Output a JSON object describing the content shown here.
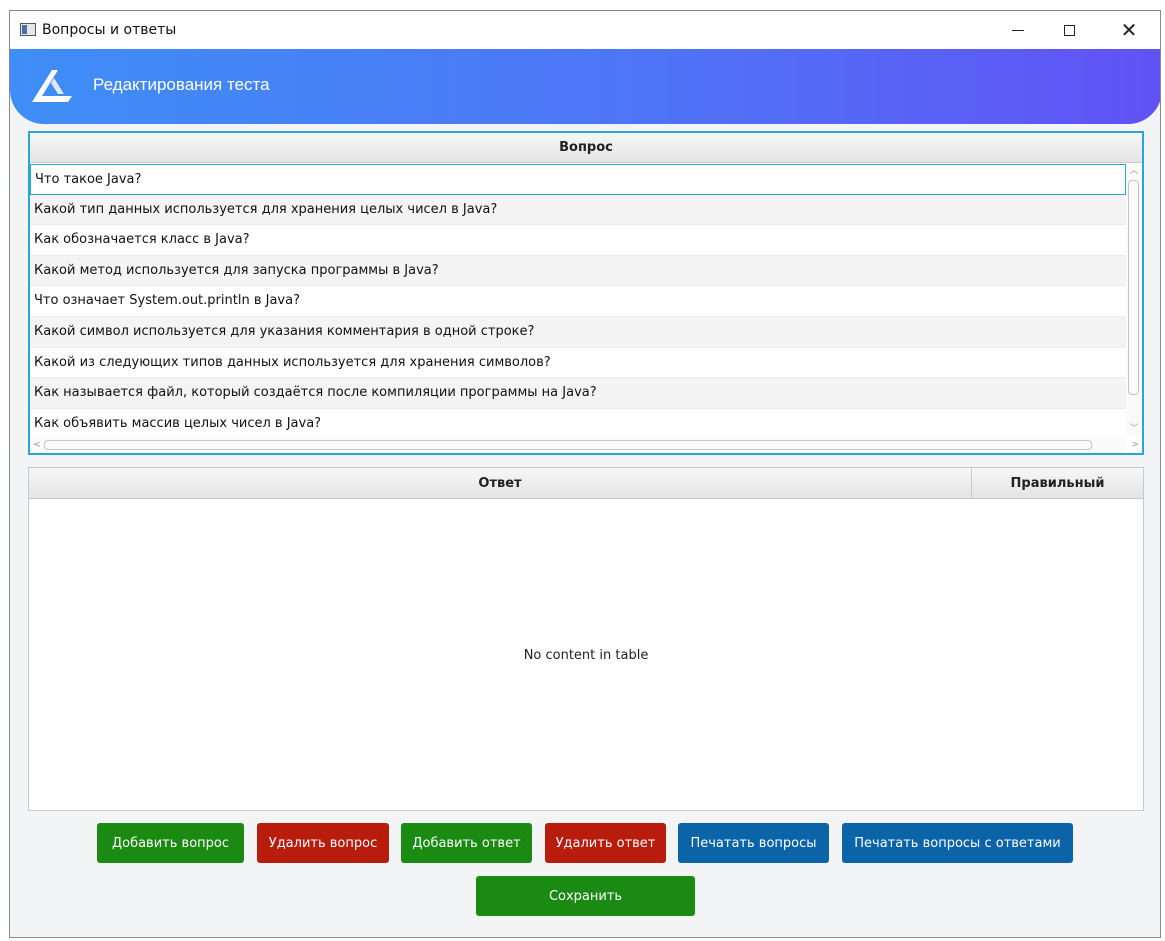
{
  "window": {
    "title": "Вопросы и ответы",
    "controls": {
      "minimize": "minimize",
      "maximize": "maximize",
      "close": "✕"
    }
  },
  "banner": {
    "title": "Редактирования теста",
    "gradient_start": "#3f8ef7",
    "gradient_end": "#6152f5"
  },
  "questions_table": {
    "header": "Вопрос",
    "selected_index": 0,
    "rows": [
      "Что такое Java?",
      "Какой тип данных используется для хранения целых чисел в Java?",
      "Как обозначается класс в Java?",
      "Какой метод используется для запуска программы в Java?",
      "Что означает System.out.println в Java?",
      "Какой символ используется для указания комментария в одной строке?",
      "Какой из следующих типов данных используется для хранения символов?",
      "Как называется файл, который создаётся после компиляции программы на Java?",
      "Как объявить массив целых чисел в Java?"
    ]
  },
  "answers_table": {
    "headers": {
      "answer": "Ответ",
      "correct": "Правильный"
    },
    "empty_message": "No content in table"
  },
  "buttons": {
    "add_question": "Добавить вопрос",
    "delete_question": "Удалить вопрос",
    "add_answer": "Добавить ответ",
    "delete_answer": "Удалить ответ",
    "print_questions": "Печатать вопросы",
    "print_questions_answers": "Печатать вопросы с ответами",
    "save": "Сохранить"
  },
  "colors": {
    "green": "#1a8a13",
    "red": "#b71c0c",
    "blue": "#0b63a8",
    "selection_border": "#2aa6d6"
  }
}
